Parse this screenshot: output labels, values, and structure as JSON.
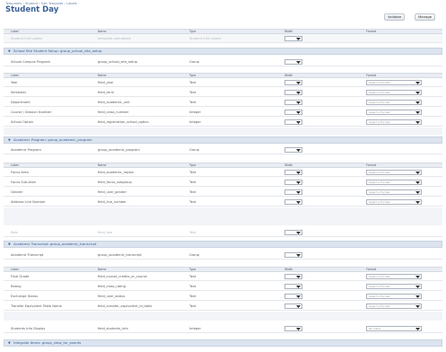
{
  "breadcrumb": "Templates › Student › Edit Template › Labels",
  "page_title": "Student Day",
  "toolbar": {
    "validate_label": "Validate",
    "manage_label": "Manage"
  },
  "columns": {
    "label": "Label",
    "name": "Name",
    "type": "Type",
    "width": "Width",
    "format": "Format"
  },
  "top_row": {
    "label": "Student Edit Labels",
    "name": "template.user.labels",
    "type": "Student Edit Labels"
  },
  "sections": [
    {
      "title": "School Site Student Setup: group_school_site_setup",
      "group": {
        "label": "School Campus Program",
        "name": "group_school_site_setup",
        "type": "Group"
      },
      "rows": [
        {
          "label": "Year",
          "name": "field_year",
          "type": "Text",
          "format": "Select a Format"
        },
        {
          "label": "Semester",
          "name": "field_term",
          "type": "Text",
          "format": "Select a Format"
        },
        {
          "label": "Department",
          "name": "field_academic_unit",
          "type": "Text",
          "format": "Select a Format"
        },
        {
          "label": "Course / Session Number",
          "name": "field_class_number",
          "type": "Integer",
          "format": "Select a Format"
        },
        {
          "label": "School Option",
          "name": "field_registration_school_option",
          "type": "Integer",
          "format": "Select a Format"
        }
      ]
    },
    {
      "title": "Academic Program: group_academic_program",
      "group": {
        "label": "Academic Program",
        "name": "group_academic_program",
        "type": "Group"
      },
      "rows": [
        {
          "label": "Focus Area",
          "name": "field_academic_region",
          "type": "Text",
          "format": "Select a Format"
        },
        {
          "label": "Focus Sub-Area",
          "name": "field_focus_subgroup",
          "type": "Text",
          "format": "Select a Format"
        },
        {
          "label": "Gender",
          "name": "field_user_gender",
          "type": "Text",
          "format": "Select a Format"
        },
        {
          "label": "Address Line Number",
          "name": "field_line_number",
          "type": "Text",
          "format": "Select a Format"
        }
      ]
    },
    {
      "title": "Academic Transcript: group_academic_transcript",
      "group": {
        "label": "Academic Transcript",
        "name": "group_academic_transcript",
        "type": "Group"
      },
      "rows": [
        {
          "label": "Final Grade",
          "name": "field_course_credits_or_course",
          "type": "Text",
          "format": "Select a Format"
        },
        {
          "label": "Rating",
          "name": "field_class_rating",
          "type": "Text",
          "format": "Select a Format"
        },
        {
          "label": "Exchange Status",
          "name": "field_user_status",
          "type": "Text",
          "format": "Select a Format"
        },
        {
          "label": "Transfer Equivalent Table Name",
          "name": "field_transfer_equivalent_id_table",
          "type": "Text",
          "format": "Select a Format"
        }
      ]
    }
  ],
  "between_row": {
    "label": "Role",
    "name": "field_role",
    "type": "Text"
  },
  "bottom_row": {
    "label": "Students Info Display",
    "name": "field_students_info",
    "type": "Integer",
    "format": "No Label"
  },
  "last_section_title": "Integrate Items: group_view_for_events",
  "width_default": "0"
}
